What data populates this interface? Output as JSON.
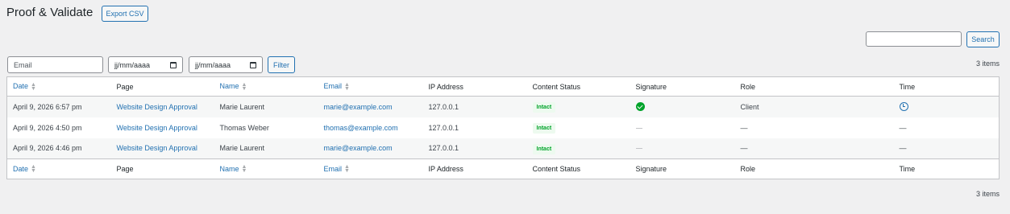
{
  "header": {
    "title": "Proof & Validate",
    "export_label": "Export CSV"
  },
  "search": {
    "value": "",
    "button_label": "Search"
  },
  "filters": {
    "email_placeholder": "Email",
    "date_from": "jj/mm/aaaa",
    "date_to": "jj/mm/aaaa",
    "filter_label": "Filter"
  },
  "items_count": "3 items",
  "columns": {
    "date": "Date",
    "page": "Page",
    "name": "Name",
    "email": "Email",
    "ip": "IP Address",
    "status": "Content Status",
    "signature": "Signature",
    "role": "Role",
    "time": "Time"
  },
  "rows": [
    {
      "date": "April 9, 2026 6:57 pm",
      "page": "Website Design Approval",
      "name": "Marie Laurent",
      "email": "marie@example.com",
      "ip": "127.0.0.1",
      "status": "Intact",
      "signature_icon": "check-circle-icon",
      "role": "Client",
      "time_icon": "clock-icon"
    },
    {
      "date": "April 9, 2026 4:50 pm",
      "page": "Website Design Approval",
      "name": "Thomas Weber",
      "email": "thomas@example.com",
      "ip": "127.0.0.1",
      "status": "Intact",
      "signature_icon": "dash-icon",
      "role": "—",
      "time": "—"
    },
    {
      "date": "April 9, 2026 4:46 pm",
      "page": "Website Design Approval",
      "name": "Marie Laurent",
      "email": "marie@example.com",
      "ip": "127.0.0.1",
      "status": "Intact",
      "signature_icon": "dash-icon",
      "role": "—",
      "time": "—"
    }
  ],
  "colors": {
    "accent": "#2271b1",
    "success": "#00a32a",
    "background": "#f0f0f1"
  }
}
